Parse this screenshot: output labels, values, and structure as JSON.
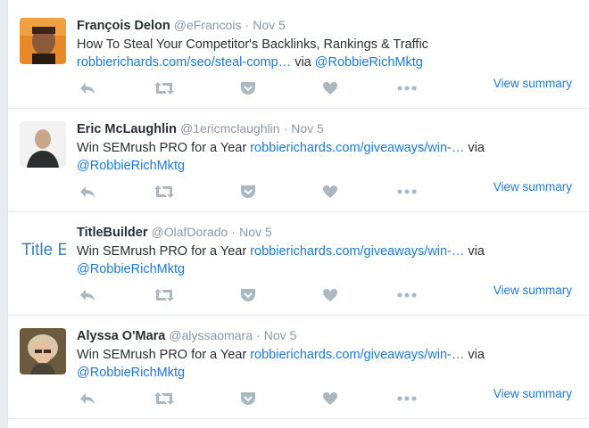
{
  "tweets": [
    {
      "name": "François Delon",
      "handle": "@eFrancois",
      "time": "Nov 5",
      "text_prefix": "How To Steal Your Competitor's Backlinks, Rankings & Traffic",
      "link": "robbierichards.com/seo/steal-comp…",
      "via": "via",
      "mention": "@RobbieRichMktg",
      "summary": "View summary"
    },
    {
      "name": "Eric McLaughlin",
      "handle": "@1ericmclaughlin",
      "time": "Nov 5",
      "text_prefix": "Win SEMrush PRO for a Year",
      "link": "robbierichards.com/giveaways/win-…",
      "via": "via",
      "mention": "@RobbieRichMktg",
      "summary": "View summary"
    },
    {
      "name": "TitleBuilder",
      "handle": "@OlafDorado",
      "time": "Nov 5",
      "avatar_text": "Title E",
      "text_prefix": "Win SEMrush PRO for a Year",
      "link": "robbierichards.com/giveaways/win-…",
      "via": "via",
      "mention": "@RobbieRichMktg",
      "summary": "View summary"
    },
    {
      "name": "Alyssa O'Mara",
      "handle": "@alyssaomara",
      "time": "Nov 5",
      "text_prefix": "Win SEMrush PRO for a Year",
      "link": "robbierichards.com/giveaways/win-…",
      "via": "via",
      "mention": "@RobbieRichMktg",
      "summary": "View summary"
    }
  ],
  "separator": "·",
  "icons": [
    "reply-icon",
    "retweet-icon",
    "pocket-icon",
    "like-icon",
    "more-icon"
  ],
  "colors": {
    "link": "#1b7ad6",
    "muted": "#8899a6",
    "icon": "#aab8c2",
    "divider": "#e1e8ed"
  }
}
